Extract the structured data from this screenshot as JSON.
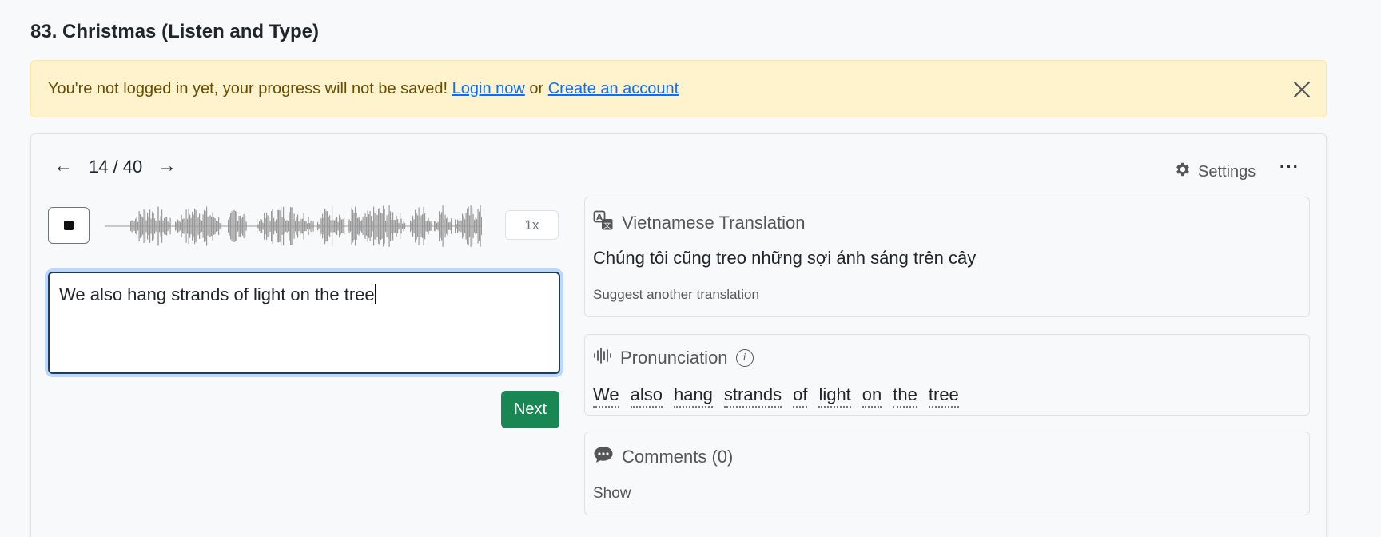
{
  "page": {
    "title": "83. Christmas (Listen and Type)"
  },
  "alert": {
    "message": "You're not logged in yet, your progress will not be saved!",
    "login_link": "Login now",
    "or_text": "or",
    "create_link": "Create an account",
    "close_icon": "close-icon"
  },
  "nav": {
    "prev_label": "←",
    "next_label": "→",
    "counter": "14 / 40",
    "current": 14,
    "total": 40
  },
  "toolbar": {
    "settings_label": "Settings",
    "settings_icon": "gear-icon",
    "more_label": "···"
  },
  "player": {
    "stop_icon": "stop-icon",
    "speed_label": "1x",
    "waveform_color": "#999999"
  },
  "answer": {
    "value": "We also hang strands of light on the tree"
  },
  "actions": {
    "next_label": "Next",
    "next_color": "#198754"
  },
  "translation": {
    "heading": "Vietnamese Translation",
    "icon": "translate-icon",
    "text": "Chúng tôi cũng treo những sợi ánh sáng trên cây",
    "suggest_link": "Suggest another translation"
  },
  "pronunciation": {
    "heading": "Pronunciation",
    "icon": "audio-wave-icon",
    "info_icon": "info-icon",
    "words": [
      "We",
      "also",
      "hang",
      "strands",
      "of",
      "light",
      "on",
      "the",
      "tree"
    ]
  },
  "comments": {
    "heading": "Comments (0)",
    "icon": "chat-bubble-icon",
    "show_link": "Show"
  },
  "colors": {
    "alert_bg": "#fff3cd",
    "link": "#0d6efd",
    "accent_green": "#198754"
  }
}
